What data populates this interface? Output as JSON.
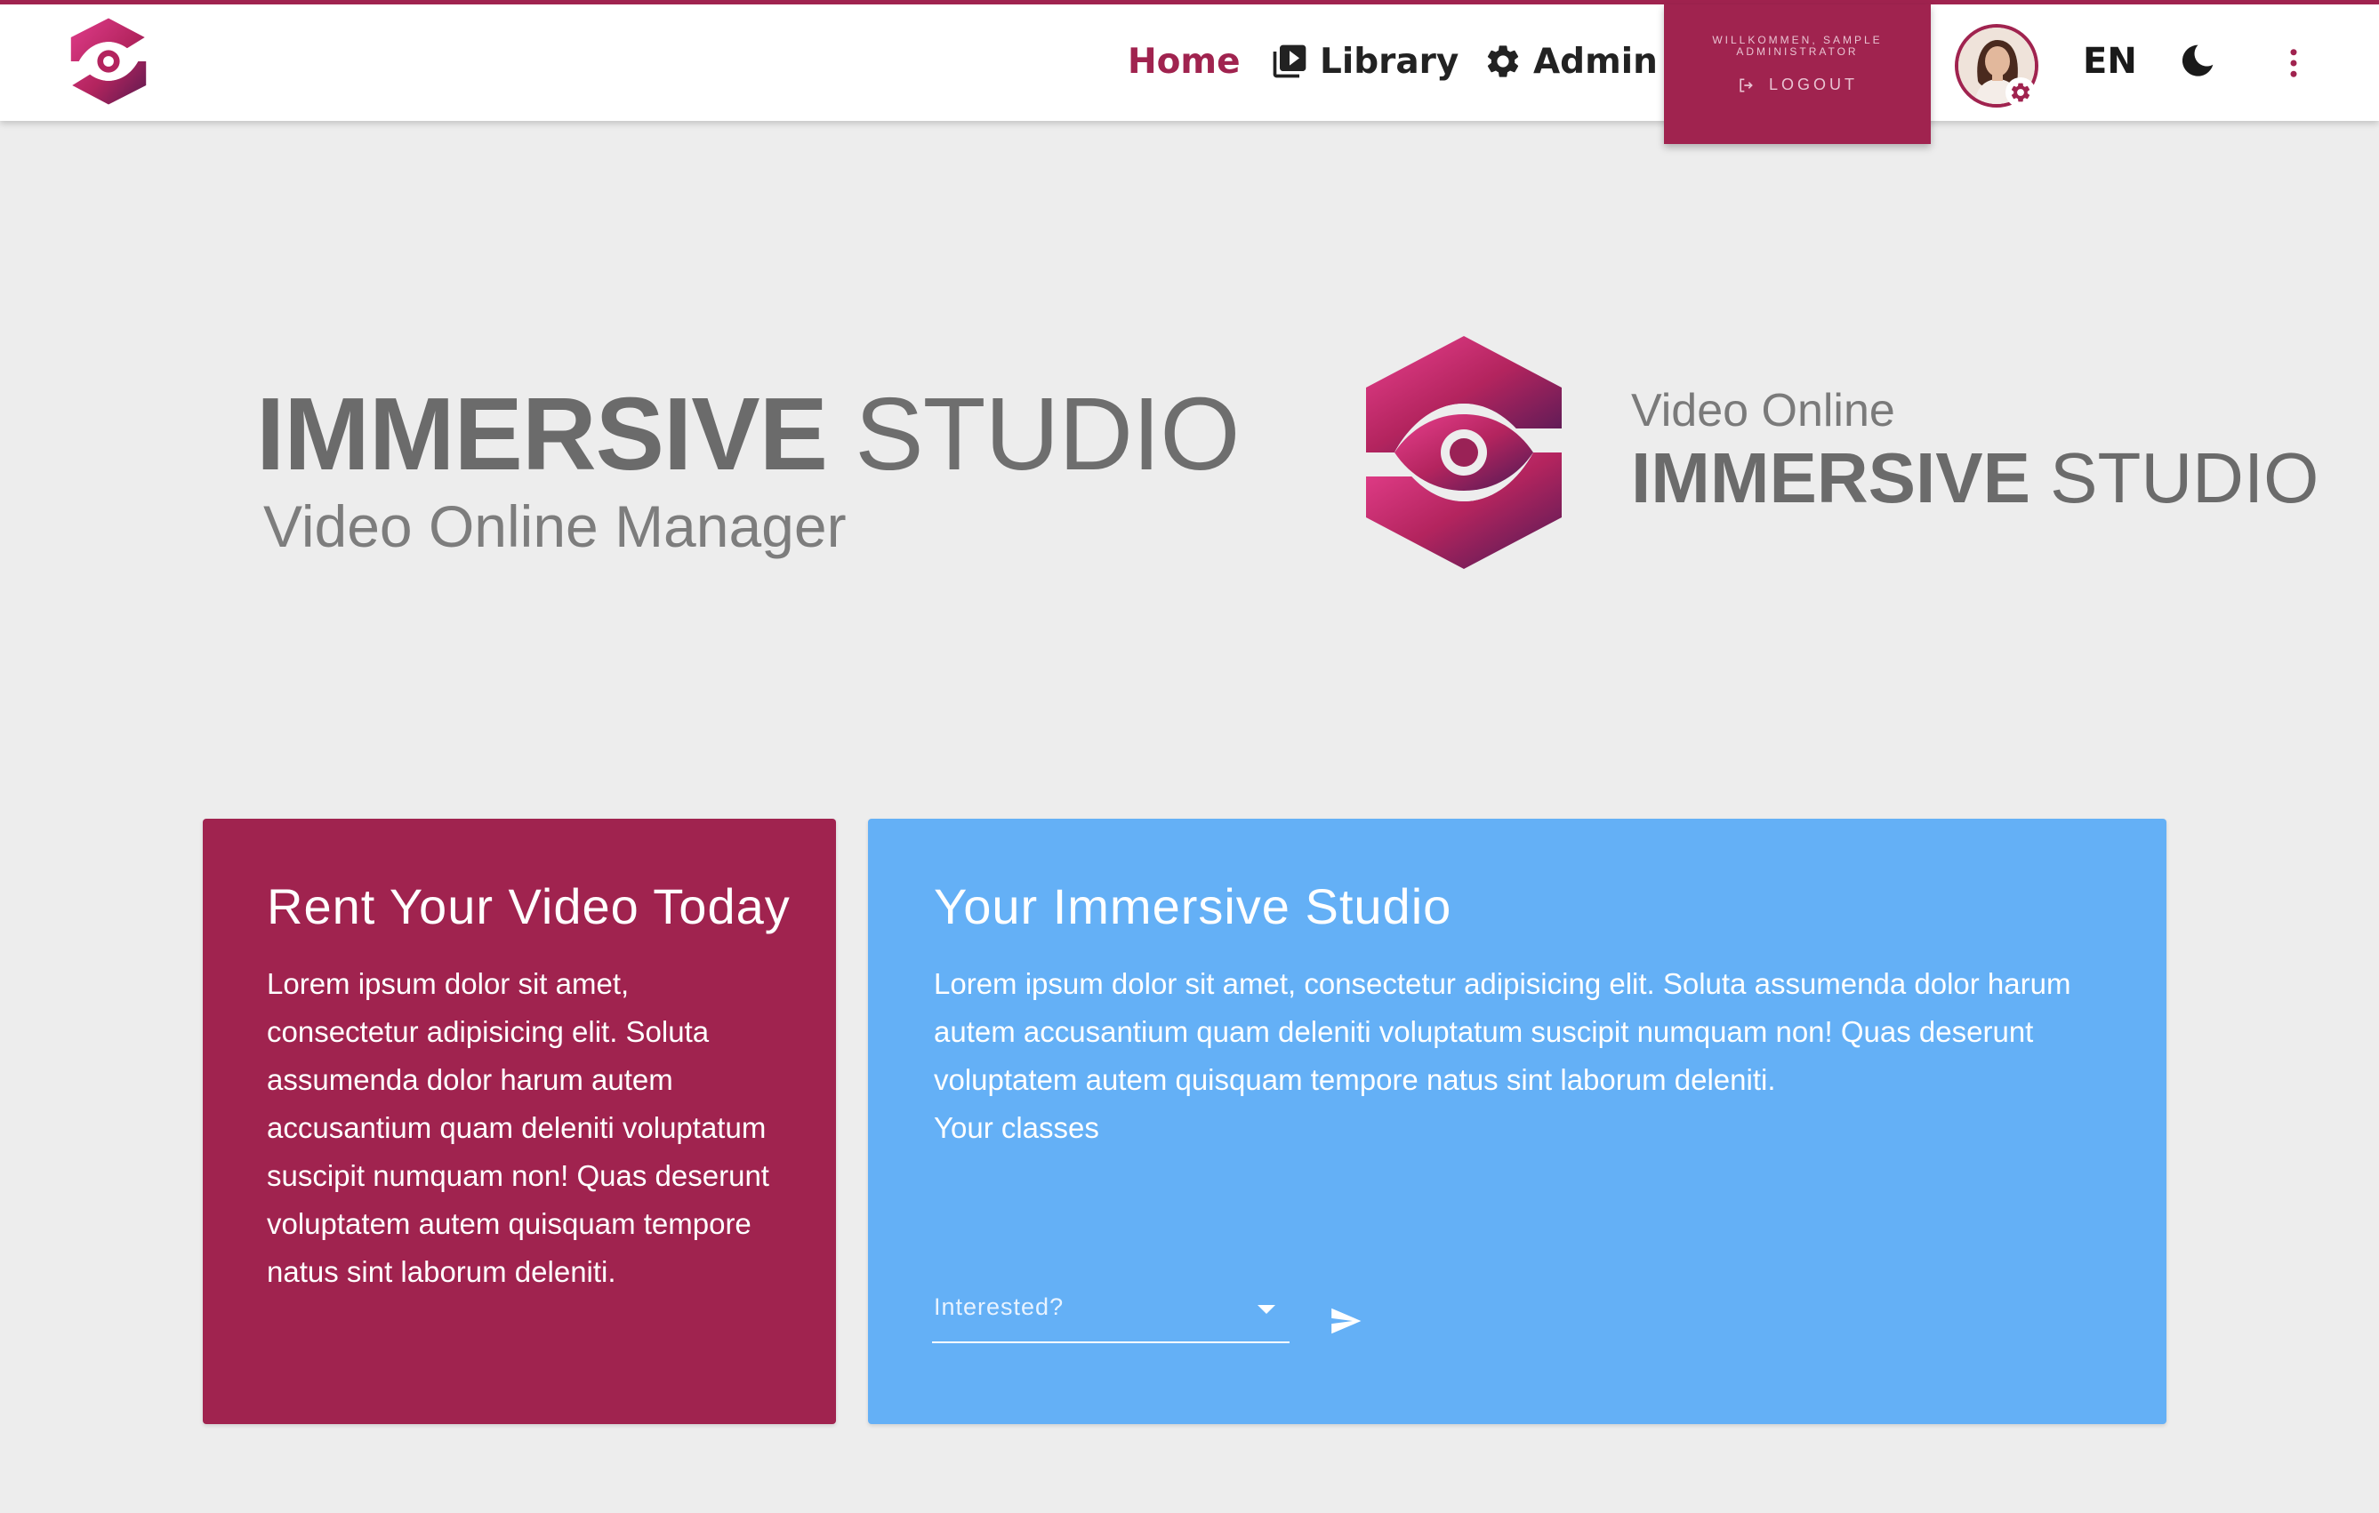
{
  "header": {
    "nav": {
      "home": "Home",
      "library": "Library",
      "admin": "Admin"
    },
    "user_panel": {
      "welcome": "WILLKOMMEN, SAMPLE ADMINISTRATOR",
      "logout": "LOGOUT"
    },
    "language": "EN"
  },
  "hero": {
    "left_title_bold": "IMMERSIVE",
    "left_title_light": " STUDIO",
    "left_subtitle": "Video Online Manager",
    "right_small": "Video Online",
    "right_title_bold": "IMMERSIVE",
    "right_title_light": " STUDIO"
  },
  "cards": {
    "rent": {
      "title": "Rent Your Video Today",
      "body": "Lorem ipsum dolor sit amet, consectetur adipisicing elit. Soluta assumenda dolor harum autem accusantium quam deleniti voluptatum suscipit numquam non! Quas deserunt voluptatem autem quisquam tempore natus sint laborum deleniti."
    },
    "studio": {
      "title": "Your Immersive Studio",
      "body": "Lorem ipsum dolor sit amet, consectetur adipisicing elit. Soluta assumenda dolor harum autem accusantium quam deleniti voluptatum suscipit numquam non! Quas deserunt voluptatem autem quisquam tempore natus sint laborum deleniti.",
      "classes": "Your classes",
      "select_placeholder": "Interested?"
    }
  },
  "colors": {
    "brand": "#a0234f",
    "accent_blue": "#64b0f6",
    "background": "#ededed"
  },
  "icons": {
    "logo": "eye-hexagon-logo",
    "library": "video-library-icon",
    "admin": "gear-icon",
    "logout": "logout-icon",
    "theme": "moon-icon",
    "menu": "kebab-menu-icon",
    "send": "send-icon"
  }
}
